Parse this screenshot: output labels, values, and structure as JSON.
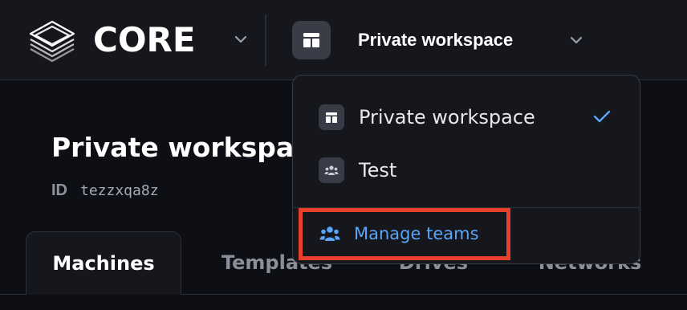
{
  "app": {
    "brand": "CORE",
    "logo_icon": "stacked-layers-logo",
    "workspace_selector_label": "Private workspace"
  },
  "page": {
    "title": "Private workspace",
    "id_label": "ID",
    "id_value": "tezzxqa8z"
  },
  "tabs": [
    {
      "label": "Machines",
      "active": true
    },
    {
      "label": "Templates",
      "active": false
    },
    {
      "label": "Drives",
      "active": false
    },
    {
      "label": "Networks",
      "active": false
    }
  ],
  "dropdown": {
    "items": [
      {
        "label": "Private workspace",
        "icon": "workspace-layout-icon",
        "selected": true
      },
      {
        "label": "Test",
        "icon": "team-icon",
        "selected": false
      }
    ],
    "manage_label": "Manage teams",
    "manage_icon": "team-icon"
  },
  "colors": {
    "background": "#0e0f14",
    "surface": "#16171d",
    "accent_blue": "#5aa5f7",
    "highlight_red": "#e8402c"
  }
}
